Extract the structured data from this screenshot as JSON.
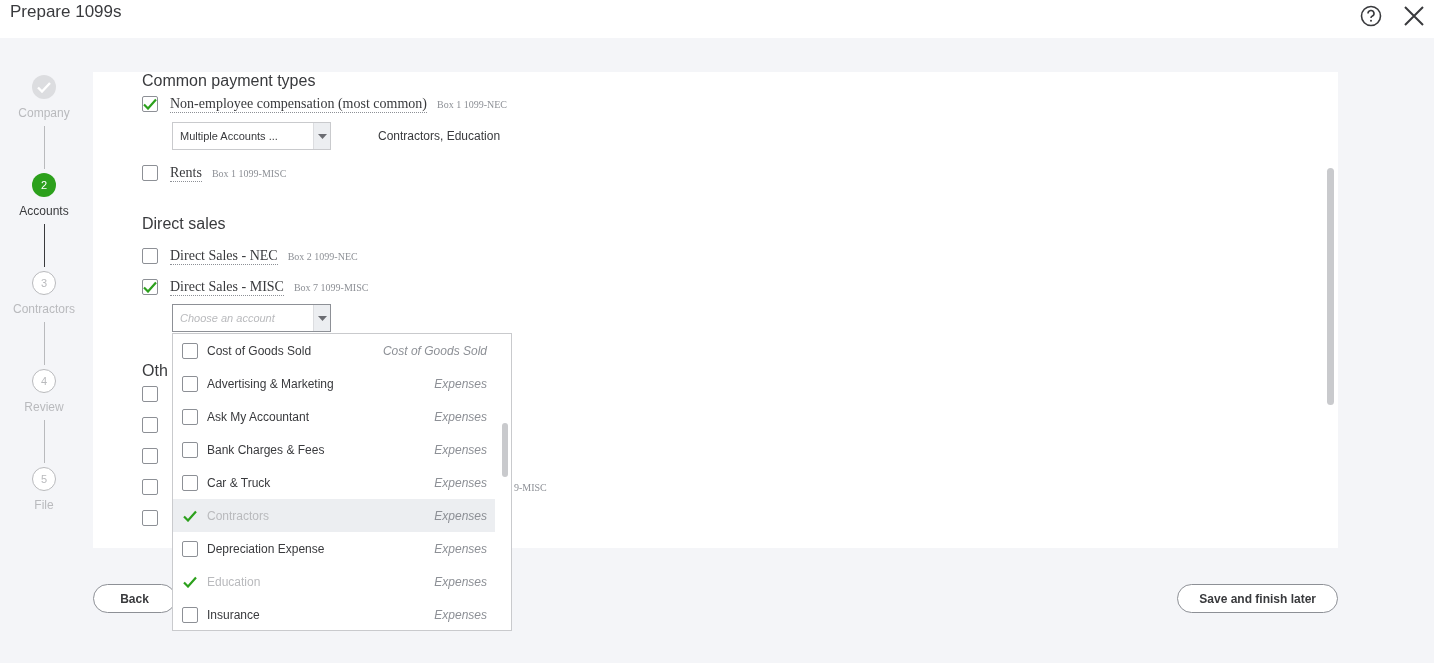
{
  "window": {
    "title": "Prepare 1099s"
  },
  "steps": [
    {
      "label": "Company",
      "done": true,
      "current": false
    },
    {
      "number": "2",
      "label": "Accounts",
      "done": false,
      "current": true
    },
    {
      "number": "3",
      "label": "Contractors",
      "done": false,
      "current": false
    },
    {
      "number": "4",
      "label": "Review",
      "done": false,
      "current": false
    },
    {
      "number": "5",
      "label": "File",
      "done": false,
      "current": false
    }
  ],
  "sections": [
    {
      "heading": "Common payment types",
      "items": [
        {
          "label": "Non-employee compensation (most common)",
          "box": "Box 1 1099-NEC",
          "checked": true,
          "account": {
            "value": "Multiple Accounts ...",
            "summary": "Contractors, Education",
            "open": false
          }
        },
        {
          "label": "Rents",
          "box": "Box 1 1099-MISC",
          "checked": false
        }
      ]
    },
    {
      "heading": "Direct sales",
      "items": [
        {
          "label": "Direct Sales - NEC",
          "box": "Box 2 1099-NEC",
          "checked": false
        },
        {
          "label": "Direct Sales - MISC",
          "box": "Box 7 1099-MISC",
          "checked": true,
          "account": {
            "placeholder": "Choose an account",
            "open": true
          }
        }
      ]
    },
    {
      "heading": "Oth",
      "items": [
        {
          "checked": false
        },
        {
          "checked": false
        },
        {
          "checked": false
        },
        {
          "checked": false,
          "box": "9-MISC"
        },
        {
          "checked": false
        }
      ]
    }
  ],
  "account_options": [
    {
      "name": "Cost of Goods Sold",
      "type": "Cost of Goods Sold",
      "checked": false,
      "highlighted": false
    },
    {
      "name": "Advertising & Marketing",
      "type": "Expenses",
      "checked": false,
      "highlighted": false
    },
    {
      "name": "Ask My Accountant",
      "type": "Expenses",
      "checked": false,
      "highlighted": false
    },
    {
      "name": "Bank Charges & Fees",
      "type": "Expenses",
      "checked": false,
      "highlighted": false
    },
    {
      "name": "Car & Truck",
      "type": "Expenses",
      "checked": false,
      "highlighted": false
    },
    {
      "name": "Contractors",
      "type": "Expenses",
      "checked": true,
      "highlighted": true
    },
    {
      "name": "Depreciation Expense",
      "type": "Expenses",
      "checked": false,
      "highlighted": false
    },
    {
      "name": "Education",
      "type": "Expenses",
      "checked": true,
      "highlighted": false
    },
    {
      "name": "Insurance",
      "type": "Expenses",
      "checked": false,
      "highlighted": false
    }
  ],
  "buttons": {
    "back": "Back",
    "save": "Save and finish later"
  }
}
